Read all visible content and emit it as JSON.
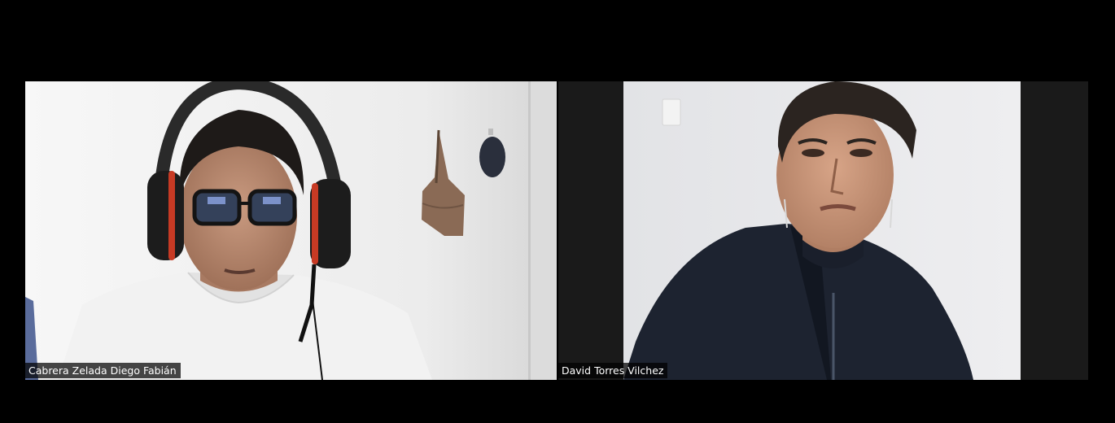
{
  "meeting": {
    "participants": [
      {
        "name": "Cabrera Zelada Diego Fabián"
      },
      {
        "name": "David Torres Vilchez"
      }
    ]
  }
}
